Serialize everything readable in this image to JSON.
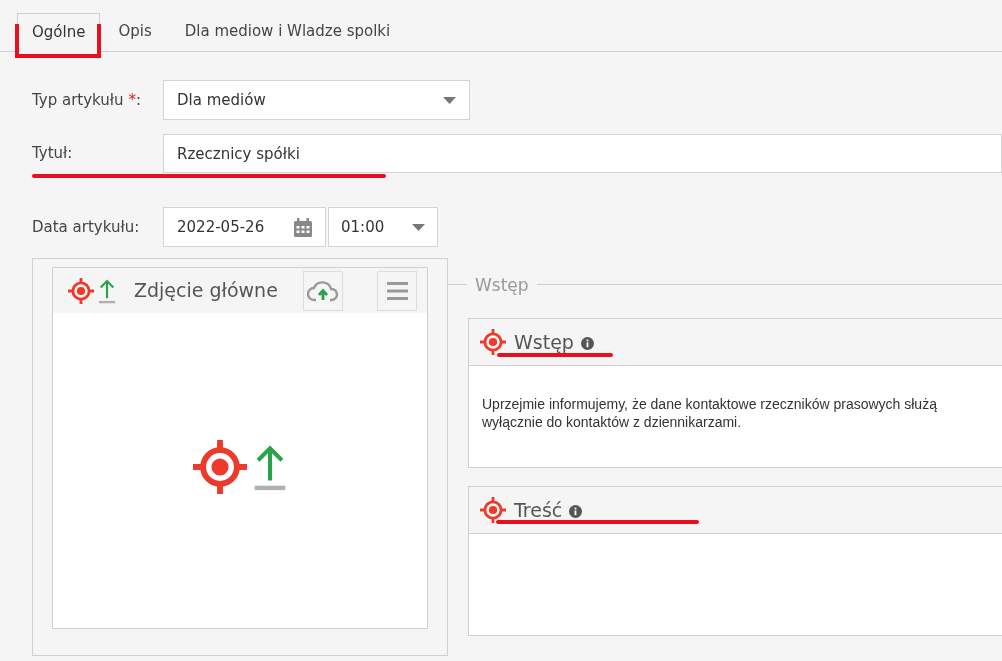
{
  "tabs": [
    {
      "label": "Ogólne",
      "selected": true
    },
    {
      "label": "Opis",
      "selected": false
    },
    {
      "label": "Dla mediow i Wladze spolki",
      "selected": false
    }
  ],
  "form": {
    "type_field": {
      "label": "Typ artykułu",
      "required_mark": "*",
      "suffix": ":",
      "value": "Dla mediów"
    },
    "title_field": {
      "label": "Tytuł:",
      "value": "Rzecznicy spółki"
    },
    "date_field": {
      "label": "Data artykułu:",
      "date": "2022-05-26",
      "time": "01:00"
    }
  },
  "main_photo": {
    "title": "Zdjęcie główne"
  },
  "intro_section": {
    "legend": "Wstęp",
    "panels": [
      {
        "title": "Wstęp",
        "text": "Uprzejmie informujemy, że dane kontaktowe rzeczników prasowych służą wyłącznie do kontaktów z dziennikarzami."
      },
      {
        "title": "Treść"
      }
    ]
  }
}
